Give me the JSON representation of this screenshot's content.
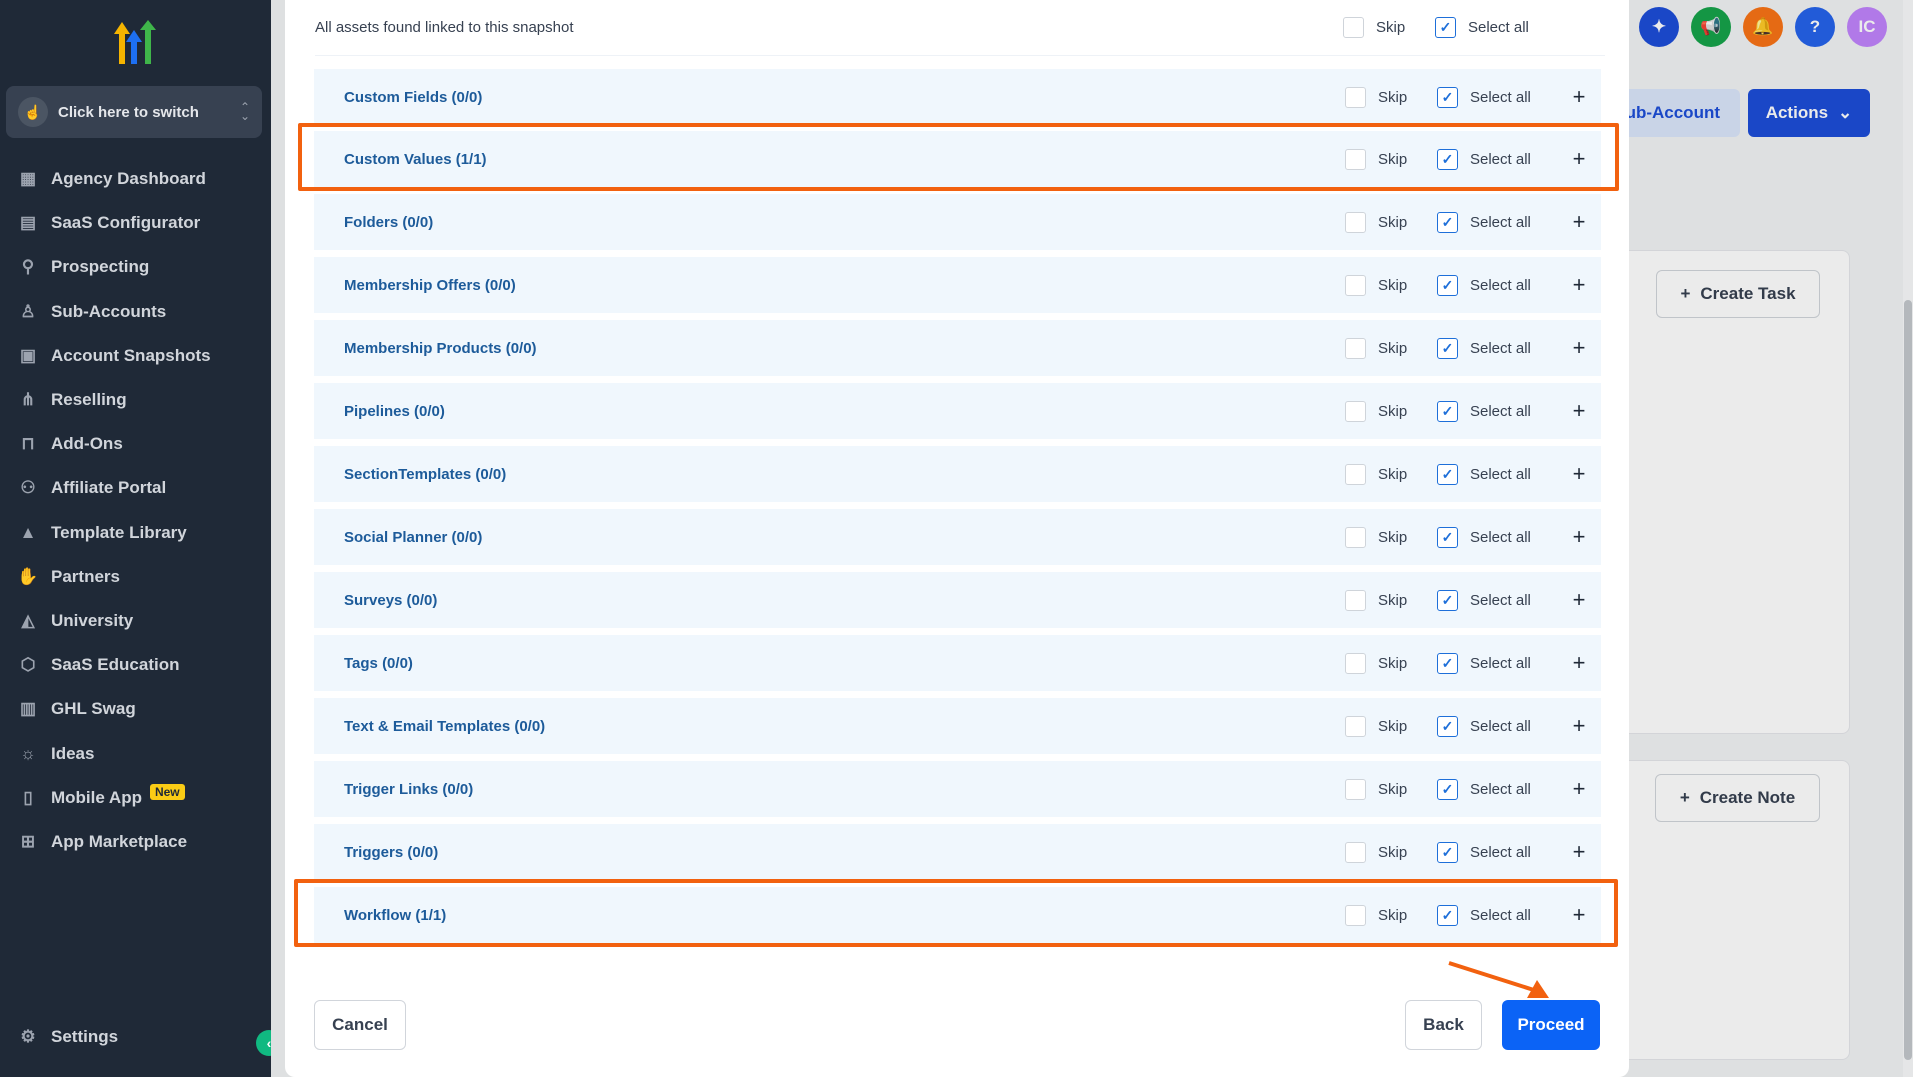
{
  "sidebar": {
    "switcher_label": "Click here to switch",
    "items": [
      {
        "label": "Agency Dashboard",
        "icon": "dashboard-icon"
      },
      {
        "label": "SaaS Configurator",
        "icon": "chart-icon"
      },
      {
        "label": "Prospecting",
        "icon": "prospect-icon"
      },
      {
        "label": "Sub-Accounts",
        "icon": "user-icon"
      },
      {
        "label": "Account Snapshots",
        "icon": "snapshot-icon"
      },
      {
        "label": "Reselling",
        "icon": "reselling-icon"
      },
      {
        "label": "Add-Ons",
        "icon": "bag-icon"
      },
      {
        "label": "Affiliate Portal",
        "icon": "users-icon"
      },
      {
        "label": "Template Library",
        "icon": "shapes-icon"
      },
      {
        "label": "Partners",
        "icon": "handshake-icon"
      },
      {
        "label": "University",
        "icon": "graduation-icon"
      },
      {
        "label": "SaaS Education",
        "icon": "box-icon"
      },
      {
        "label": "GHL Swag",
        "icon": "store-icon"
      },
      {
        "label": "Ideas",
        "icon": "lightbulb-icon"
      },
      {
        "label": "Mobile App",
        "icon": "phone-icon",
        "badge": "New"
      },
      {
        "label": "App Marketplace",
        "icon": "grid-icon"
      }
    ],
    "settings_label": "Settings"
  },
  "background": {
    "subaccount_label": "ub-Account",
    "actions_label": "Actions",
    "create_task_label": "Create Task",
    "create_note_label": "Create Note",
    "avatar_initials": "IC"
  },
  "modal": {
    "header_text": "All assets found linked to this snapshot",
    "skip_label": "Skip",
    "select_all_label": "Select all",
    "rows": [
      {
        "label": "Custom Fields (0/0)"
      },
      {
        "label": "Custom Values (1/1)"
      },
      {
        "label": "Folders (0/0)"
      },
      {
        "label": "Membership Offers (0/0)"
      },
      {
        "label": "Membership Products (0/0)"
      },
      {
        "label": "Pipelines (0/0)"
      },
      {
        "label": "SectionTemplates (0/0)"
      },
      {
        "label": "Social Planner (0/0)"
      },
      {
        "label": "Surveys (0/0)"
      },
      {
        "label": "Tags (0/0)"
      },
      {
        "label": "Text & Email Templates (0/0)"
      },
      {
        "label": "Trigger Links (0/0)"
      },
      {
        "label": "Triggers (0/0)"
      },
      {
        "label": "Workflow (1/1)"
      }
    ],
    "cancel_label": "Cancel",
    "back_label": "Back",
    "proceed_label": "Proceed"
  },
  "colors": {
    "highlight": "#f2610f",
    "primary": "#0b63f6",
    "row_bg": "#f0f7fd",
    "row_text": "#1d5b9a"
  }
}
